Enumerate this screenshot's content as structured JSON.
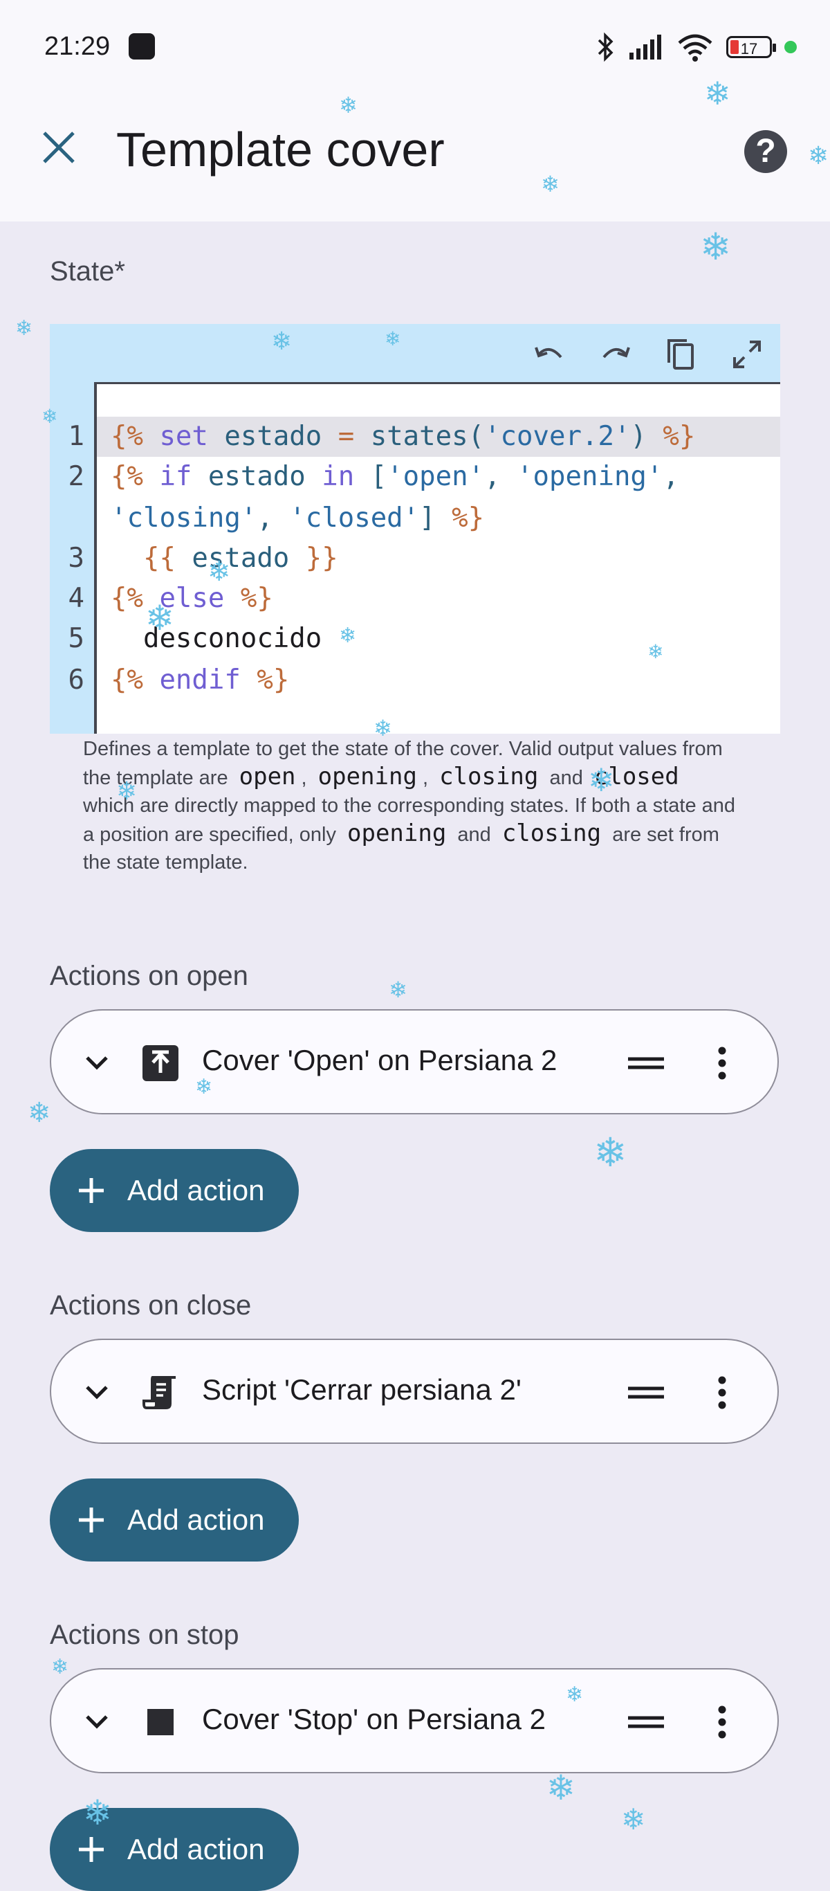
{
  "status_bar": {
    "time": "21:29",
    "battery_level": "17",
    "icons": [
      "bluetooth-icon",
      "signal-icon",
      "wifi-icon",
      "battery-icon"
    ]
  },
  "app_bar": {
    "title": "Template cover",
    "close_icon": "close-icon",
    "help_icon": "help-icon",
    "help_glyph": "?"
  },
  "state_section": {
    "label": "State*",
    "editor_tools": [
      "undo-icon",
      "redo-icon",
      "copy-icon",
      "fullscreen-icon"
    ],
    "code_lines": [
      {
        "n": "1",
        "parts": [
          [
            "{%",
            "delim"
          ],
          [
            " set ",
            "kw"
          ],
          [
            "estado ",
            "var"
          ],
          [
            "=",
            "delim"
          ],
          [
            " states(",
            "var"
          ],
          [
            "'cover.2'",
            "str"
          ],
          [
            ") ",
            "var"
          ],
          [
            "%}",
            "delim"
          ]
        ]
      },
      {
        "n": "2",
        "parts": [
          [
            "{%",
            "delim"
          ],
          [
            " if ",
            "kw"
          ],
          [
            "estado ",
            "var"
          ],
          [
            "in ",
            "kw"
          ],
          [
            "[",
            "var"
          ],
          [
            "'open'",
            "str"
          ],
          [
            ", ",
            "var"
          ],
          [
            "'opening'",
            "str"
          ],
          [
            ",",
            "var"
          ]
        ]
      },
      {
        "n": "",
        "parts": [
          [
            "'closing'",
            "str"
          ],
          [
            ", ",
            "var"
          ],
          [
            "'closed'",
            "str"
          ],
          [
            "] ",
            "var"
          ],
          [
            "%}",
            "delim"
          ]
        ]
      },
      {
        "n": "3",
        "parts": [
          [
            "  {{",
            "delim"
          ],
          [
            " estado ",
            "var"
          ],
          [
            "}}",
            "delim"
          ]
        ]
      },
      {
        "n": "4",
        "parts": [
          [
            "{%",
            "delim"
          ],
          [
            " else ",
            "kw"
          ],
          [
            "%}",
            "delim"
          ]
        ]
      },
      {
        "n": "5",
        "parts": [
          [
            "  desconocido",
            "txt"
          ]
        ]
      },
      {
        "n": "6",
        "parts": [
          [
            "{%",
            "delim"
          ],
          [
            " endif ",
            "kw"
          ],
          [
            "%}",
            "delim"
          ]
        ]
      }
    ],
    "helper_text": {
      "intro": "Defines a template to get the state of the cover. Valid output values from the template are",
      "open": "open",
      "comma": ",",
      "opening": "opening",
      "closing": "closing",
      "and": "and",
      "closed": "closed",
      "mapped": "which are directly mapped to the corresponding states. If both a state and a position are specified, only",
      "are_set": "are set from the state template."
    }
  },
  "sections": [
    {
      "label": "Actions on open",
      "action": {
        "label": "Cover 'Open' on Persiana 2",
        "icon": "arrow-up-box-icon"
      },
      "add_label": "Add action"
    },
    {
      "label": "Actions on close",
      "action": {
        "label": "Script 'Cerrar persiana 2'",
        "icon": "script-icon"
      },
      "add_label": "Add action"
    },
    {
      "label": "Actions on stop",
      "action": {
        "label": "Cover 'Stop' on Persiana 2",
        "icon": "stop-square-icon"
      },
      "add_label": "Add action"
    }
  ],
  "decor": {
    "snowflake_glyph": "❄",
    "accent_color": "#2a6380",
    "snow_color": "#68c2e6"
  }
}
